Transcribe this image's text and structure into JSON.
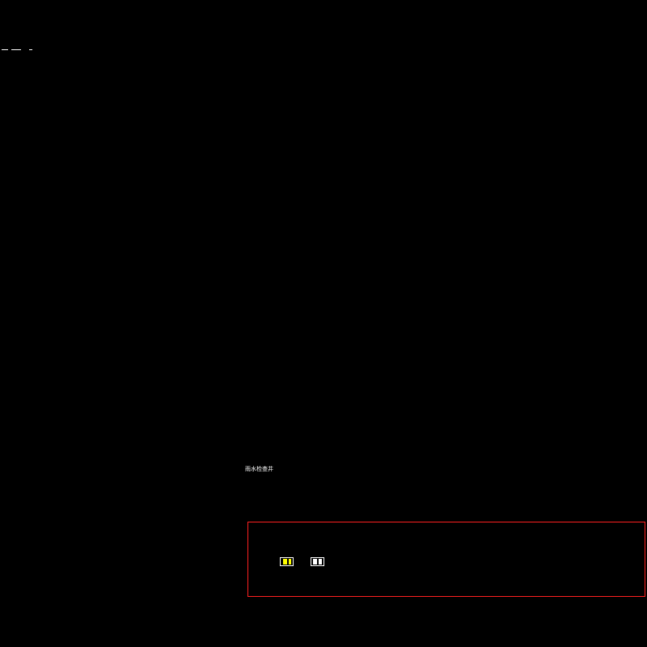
{
  "drawing": {
    "background": "#000000",
    "line_color": "#ffffff",
    "frame_color": "#ff2020",
    "caption": "雨水检查井",
    "stamps": [
      {
        "name": "stamp-yellow",
        "fill": "#ffff00"
      },
      {
        "name": "stamp-white",
        "fill": "#ffffff"
      }
    ]
  }
}
